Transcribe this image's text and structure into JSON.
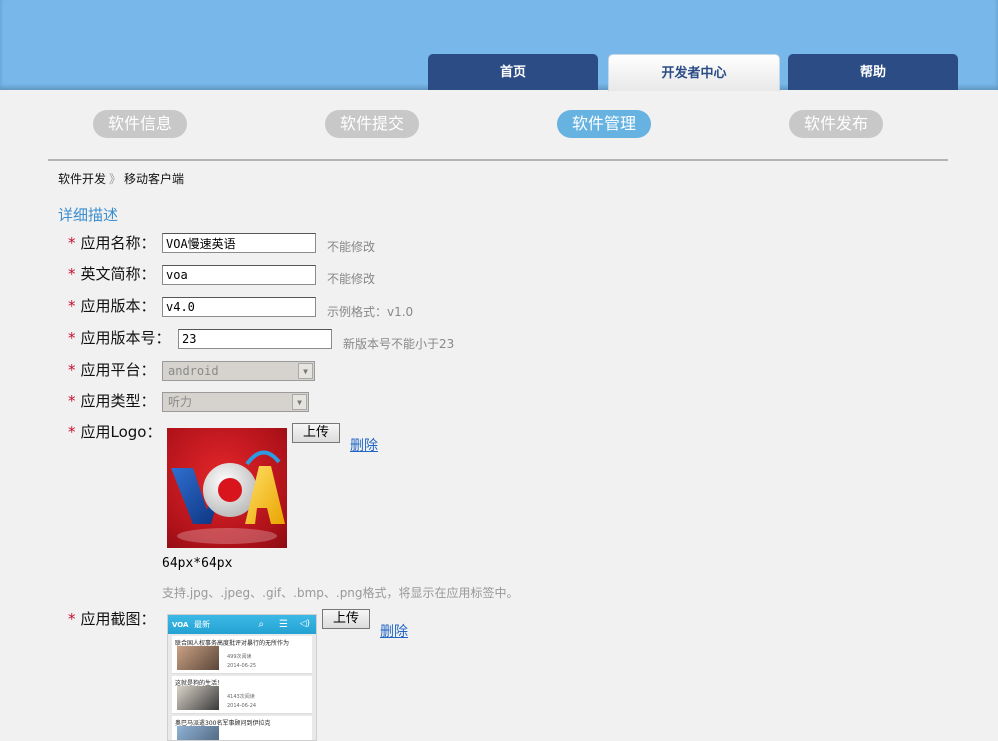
{
  "nav": {
    "tabs": [
      {
        "label": "首页",
        "active": false
      },
      {
        "label": "开发者中心",
        "active": true
      },
      {
        "label": "帮助",
        "active": false
      }
    ]
  },
  "subnav": {
    "items": [
      {
        "label": "软件信息",
        "active": false
      },
      {
        "label": "软件提交",
        "active": false
      },
      {
        "label": "软件管理",
        "active": true
      },
      {
        "label": "软件发布",
        "active": false
      }
    ]
  },
  "breadcrumb": {
    "root": "软件开发",
    "separator": "》",
    "current": "移动客户端"
  },
  "section_title": "详细描述",
  "form": {
    "required_mark": "*",
    "app_name": {
      "label": "应用名称：",
      "value": "VOA慢速英语",
      "hint": "不能修改"
    },
    "english_name": {
      "label": "英文简称：",
      "value": "voa",
      "hint": "不能修改"
    },
    "version": {
      "label": "应用版本：",
      "value": "v4.0",
      "hint": "示例格式：v1.0"
    },
    "version_code": {
      "label": "应用版本号：",
      "value": "23",
      "hint": "新版本号不能小于23"
    },
    "platform": {
      "label": "应用平台：",
      "value": "android"
    },
    "category": {
      "label": "应用类型：",
      "value": "听力"
    },
    "logo": {
      "label": "应用Logo：",
      "upload_label": "上传",
      "delete_label": "删除",
      "size_note": "64px*64px",
      "format_note": "支持.jpg、.jpeg、.gif、.bmp、.png格式，将显示在应用标签中。"
    },
    "screenshot": {
      "label": "应用截图：",
      "upload_label": "上传",
      "delete_label": "删除",
      "preview": {
        "tab_label": "最新",
        "cards": [
          {
            "title": "联合国人权事务高度批评对暴行的无所作为",
            "views": "499次阅读",
            "date": "2014-06-25"
          },
          {
            "title": "这就是狗的生活！",
            "views": "4143次阅读",
            "date": "2014-06-24"
          },
          {
            "title": "奥巴马派遣300名军事顾问到伊拉克",
            "views": "",
            "date": ""
          }
        ]
      }
    }
  },
  "colors": {
    "header_bg": "#77b7ea",
    "tab_dark": "#2b4c84",
    "pill_active": "#66b2e1",
    "pill_inactive": "#c8c8c8",
    "required": "#c8102e",
    "link": "#2166c4"
  }
}
